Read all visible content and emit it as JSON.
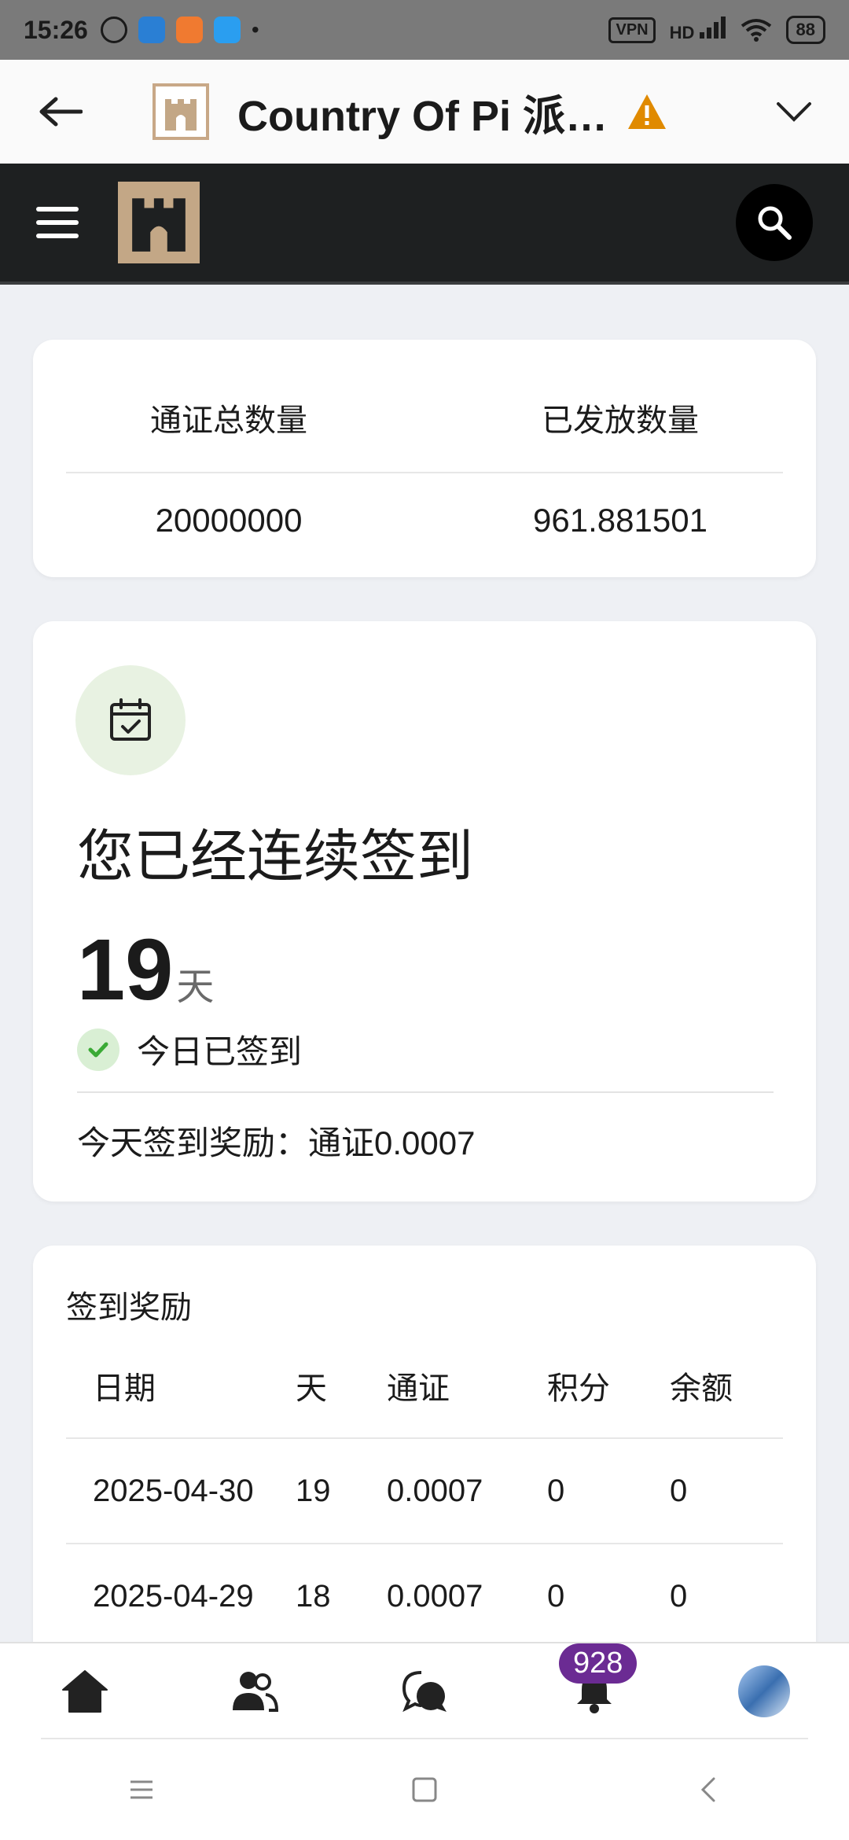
{
  "status_bar": {
    "time": "15:26",
    "vpn": "VPN",
    "network": "HD",
    "battery": "88"
  },
  "app_bar": {
    "title": "Country Of Pi 派…"
  },
  "stats": {
    "total_label": "通证总数量",
    "issued_label": "已发放数量",
    "total_value": "20000000",
    "issued_value": "961.881501"
  },
  "checkin": {
    "consecutive_text": "您已经连续签到",
    "days": "19",
    "days_unit": "天",
    "status": "今日已签到",
    "reward_text": "今天签到奖励：通证0.0007"
  },
  "rewards_table": {
    "title": "签到奖励",
    "headers": [
      "日期",
      "天",
      "通证",
      "积分",
      "余额"
    ],
    "rows": [
      [
        "2025-04-30",
        "19",
        "0.0007",
        "0",
        "0"
      ],
      [
        "2025-04-29",
        "18",
        "0.0007",
        "0",
        "0"
      ]
    ]
  },
  "bottom_nav": {
    "notification_count": "928"
  },
  "colors": {
    "accent": "#6b2b93",
    "gold": "#c3a786",
    "dark_header": "#1e2021",
    "success": "#3aaa35",
    "warning": "#e08a00"
  }
}
